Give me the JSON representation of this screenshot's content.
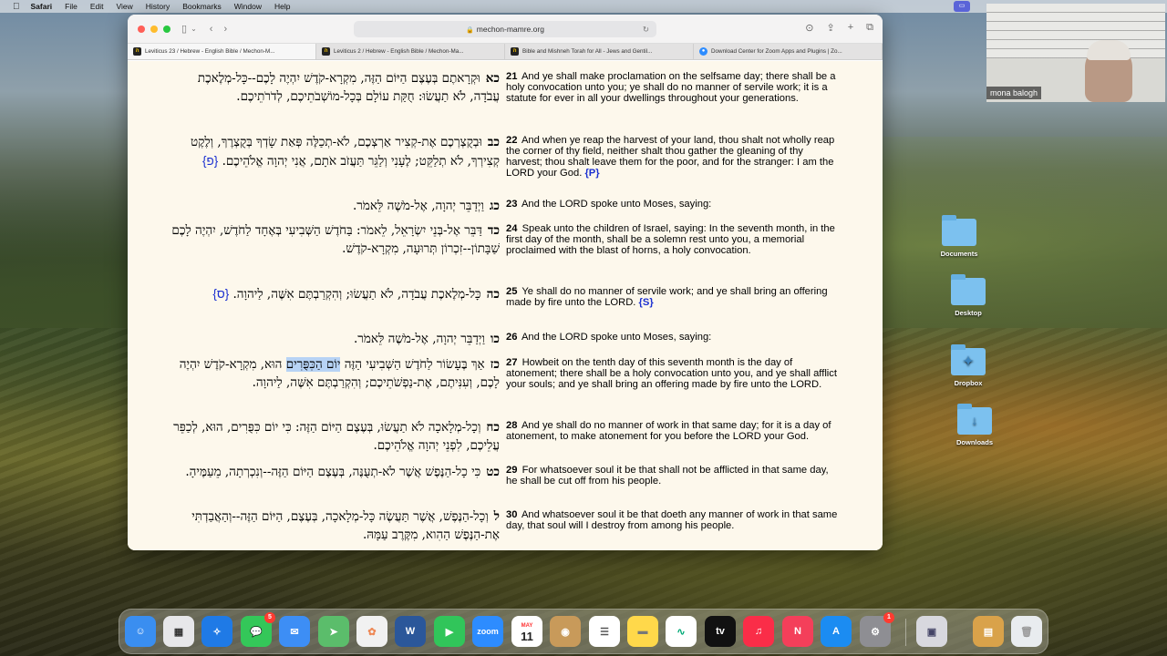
{
  "menubar": {
    "apple": "",
    "app": "Safari",
    "items": [
      "File",
      "Edit",
      "View",
      "History",
      "Bookmarks",
      "Window",
      "Help"
    ]
  },
  "video": {
    "participant": "mona balogh"
  },
  "desktop": {
    "icons": [
      {
        "label": "Documents",
        "icon": "folder-icon"
      },
      {
        "label": "Desktop",
        "icon": "folder-icon"
      },
      {
        "label": "Dropbox",
        "icon": "dropbox-folder-icon"
      },
      {
        "label": "Downloads",
        "icon": "download-folder-icon"
      }
    ]
  },
  "browser": {
    "url": "mechon-mamre.org",
    "tabs": [
      {
        "title": "Leviticus 23 / Hebrew - English Bible / Mechon-M...",
        "icon": "mechon-mamre-icon",
        "active": true
      },
      {
        "title": "Leviticus 2 / Hebrew - English Bible / Mechon-Ma...",
        "icon": "mechon-mamre-icon",
        "active": false
      },
      {
        "title": "Bible and Mishneh Torah for All - Jews and Gentil...",
        "icon": "mechon-mamre-icon",
        "active": false
      },
      {
        "title": "Download Center for Zoom Apps and Plugins | Zo...",
        "icon": "zoom-icon",
        "active": false
      }
    ]
  },
  "verses": [
    {
      "num": "21",
      "heb_num": "כא",
      "heb": "וּקְרָאתֶם בְּעֶצֶם הַיּוֹם הַזֶּה, מִקְרָא-קֹדֶשׁ יִהְיֶה לָכֶם--כָּל-מְלֶאכֶת עֲבֹדָה, לֹא תַעֲשׂוּ: חֻקַּת עוֹלָם בְּכָל-מוֹשְׁבֹתֵיכֶם, לְדֹרֹתֵיכֶם.",
      "heb_mark": "",
      "eng": "And ye shall make proclamation on the selfsame day; there shall be a holy convocation unto you; ye shall do no manner of servile work; it is a statute for ever in all your dwellings throughout your generations.",
      "mark": ""
    },
    {
      "num": "22",
      "heb_num": "כב",
      "heb": "וּבְקֻצְרְכֶם אֶת-קְצִיר אַרְצְכֶם, לֹא-תְכַלֶּה פְּאַת שָׂדְךָ בְּקֻצְרֶךָ, וְלֶקֶט קְצִירְךָ, לֹא תְלַקֵּט; לֶעָנִי וְלַגֵּר תַּעֲזֹב אֹתָם, אֲנִי יְהוָה אֱלֹהֵיכֶם.",
      "heb_mark": "{פ}",
      "eng": "And when ye reap the harvest of your land, thou shalt not wholly reap the corner of thy field, neither shalt thou gather the gleaning of thy harvest; thou shalt leave them for the poor, and for the stranger: I am the LORD your God.",
      "mark": "{P}"
    },
    {
      "num": "23",
      "heb_num": "כג",
      "heb": "וַיְדַבֵּר יְהוָה, אֶל-מֹשֶׁה לֵּאמֹר.",
      "heb_mark": "",
      "eng": "And the LORD spoke unto Moses, saying:",
      "mark": ""
    },
    {
      "num": "24",
      "heb_num": "כד",
      "heb": "דַּבֵּר אֶל-בְּנֵי יִשְׂרָאֵל, לֵאמֹר: בַּחֹדֶשׁ הַשְּׁבִיעִי בְּאֶחָד לַחֹדֶשׁ, יִהְיֶה לָכֶם שַׁבָּתוֹן--זִכְרוֹן תְּרוּעָה, מִקְרָא-קֹדֶשׁ.",
      "heb_mark": "",
      "eng": "Speak unto the children of Israel, saying: In the seventh month, in the first day of the month, shall be a solemn rest unto you, a memorial proclaimed with the blast of horns, a holy convocation.",
      "mark": ""
    },
    {
      "num": "25",
      "heb_num": "כה",
      "heb": "כָּל-מְלֶאכֶת עֲבֹדָה, לֹא תַעֲשׂוּ; וְהִקְרַבְתֶּם אִשֶּׁה, לַיהוָה.",
      "heb_mark": "{ס}",
      "eng": "Ye shall do no manner of servile work; and ye shall bring an offering made by fire unto the LORD.",
      "mark": "{S}"
    },
    {
      "num": "26",
      "heb_num": "כו",
      "heb": "וַיְדַבֵּר יְהוָה, אֶל-מֹשֶׁה לֵּאמֹר.",
      "heb_mark": "",
      "eng": "And the LORD spoke unto Moses, saying:",
      "mark": ""
    },
    {
      "num": "27",
      "heb_num": "כז",
      "heb_pre": "אַךְ בֶּעָשׂוֹר לַחֹדֶשׁ הַשְּׁבִיעִי הַזֶּה ",
      "heb_hl": "יוֹם הַכִּפֻּרִים",
      "heb": " הוּא, מִקְרָא-קֹדֶשׁ יִהְיֶה לָכֶם, וְעִנִּיתֶם, אֶת-נַפְשֹׁתֵיכֶם; וְהִקְרַבְתֶּם אִשֶּׁה, לַיהוָה.",
      "heb_mark": "",
      "eng": "Howbeit on the tenth day of this seventh month is the day of atonement; there shall be a holy convocation unto you, and ye shall afflict your souls; and ye shall bring an offering made by fire unto the LORD.",
      "mark": ""
    },
    {
      "num": "28",
      "heb_num": "כח",
      "heb": "וְכָל-מְלָאכָה לֹא תַעֲשׂוּ, בְּעֶצֶם הַיּוֹם הַזֶּה: כִּי יוֹם כִּפֻּרִים, הוּא, לְכַפֵּר עֲלֵיכֶם, לִפְנֵי יְהוָה אֱלֹהֵיכֶם.",
      "heb_mark": "",
      "eng": "And ye shall do no manner of work in that same day; for it is a day of atonement, to make atonement for you before the LORD your God.",
      "mark": ""
    },
    {
      "num": "29",
      "heb_num": "כט",
      "heb": "כִּי כָל-הַנֶּפֶשׁ אֲשֶׁר לֹא-תְעֻנֶּה, בְּעֶצֶם הַיּוֹם הַזֶּה--וְנִכְרְתָה, מֵעַמֶּיהָ.",
      "heb_mark": "",
      "eng": "For whatsoever soul it be that shall not be afflicted in that same day, he shall be cut off from his people.",
      "mark": ""
    },
    {
      "num": "30",
      "heb_num": "ל",
      "heb": "וְכָל-הַנֶּפֶשׁ, אֲשֶׁר תַּעֲשֶׂה כָּל-מְלָאכָה, בְּעֶצֶם, הַיּוֹם הַזֶּה--וְהַאֲבַדְתִּי אֶת-הַנֶּפֶשׁ הַהִוא, מִקֶּרֶב עַמָּהּ.",
      "heb_mark": "",
      "eng": "And whatsoever soul it be that doeth any manner of work in that same day, that soul will I destroy from among his people.",
      "mark": ""
    }
  ],
  "dock": {
    "items": [
      {
        "name": "finder-icon",
        "color": "#3a8ef0"
      },
      {
        "name": "launchpad-icon",
        "color": "#e7e7ea"
      },
      {
        "name": "safari-icon",
        "color": "#1f7ae6"
      },
      {
        "name": "messages-icon",
        "color": "#34c759",
        "badge": "5"
      },
      {
        "name": "mail-icon",
        "color": "#3d8ef5"
      },
      {
        "name": "maps-icon",
        "color": "#5bbd6b"
      },
      {
        "name": "photos-icon",
        "color": "#f1f1f1"
      },
      {
        "name": "word-icon",
        "color": "#2b579a"
      },
      {
        "name": "facetime-icon",
        "color": "#31c55a"
      },
      {
        "name": "zoom-icon",
        "color": "#2d8cff",
        "text": "zoom"
      },
      {
        "name": "calendar-icon",
        "color": "#ffffff",
        "month": "MAY",
        "day": "11"
      },
      {
        "name": "contacts-icon",
        "color": "#c89a5a"
      },
      {
        "name": "reminders-icon",
        "color": "#ffffff"
      },
      {
        "name": "notes-icon",
        "color": "#ffd84a"
      },
      {
        "name": "freeform-icon",
        "color": "#ffffff"
      },
      {
        "name": "appletv-icon",
        "color": "#111111",
        "text": "tv"
      },
      {
        "name": "music-icon",
        "color": "#fa2d48"
      },
      {
        "name": "news-icon",
        "color": "#f43f5a"
      },
      {
        "name": "appstore-icon",
        "color": "#1b8cf2"
      },
      {
        "name": "settings-icon",
        "color": "#8e8e93",
        "badge": "1"
      },
      {
        "name": "preview-icon",
        "color": "#d8d8de"
      },
      {
        "name": "archive-icon",
        "color": "#d9a24a"
      },
      {
        "name": "trash-icon",
        "color": "#e9ecef"
      }
    ]
  }
}
